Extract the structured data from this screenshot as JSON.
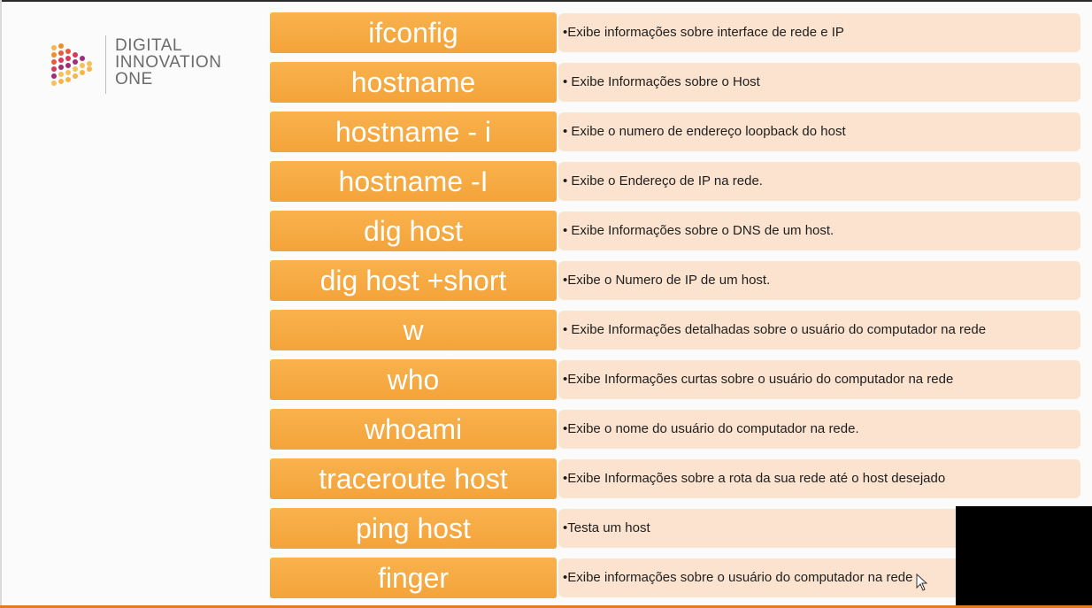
{
  "logo": {
    "line1": "DIGITAL",
    "line2": "INNOVATION",
    "line3": "ONE"
  },
  "colors": {
    "command_bg": "#f4a33a",
    "description_bg": "#fbe3d0",
    "accent_bottom": "#e07b23"
  },
  "commands": [
    {
      "name": "ifconfig",
      "desc": "•Exibe informações sobre interface de rede e IP"
    },
    {
      "name": "hostname",
      "desc": "• Exibe Informações sobre o Host"
    },
    {
      "name": "hostname - i",
      "desc": "• Exibe o numero de endereço loopback do host"
    },
    {
      "name": "hostname -I",
      "desc": "• Exibe o Endereço de IP na rede."
    },
    {
      "name": "dig host",
      "desc": "• Exibe Informações sobre o DNS de um host."
    },
    {
      "name": "dig host +short",
      "desc": "•Exibe o Numero de IP de um host."
    },
    {
      "name": "w",
      "desc": "• Exibe Informações detalhadas sobre o usuário do computador na rede"
    },
    {
      "name": "who",
      "desc": "•Exibe Informações curtas sobre o usuário do computador na rede"
    },
    {
      "name": "whoami",
      "desc": "•Exibe o nome do usuário do computador na rede."
    },
    {
      "name": "traceroute host",
      "desc": "•Exibe Informações sobre a rota da sua rede até o host desejado"
    },
    {
      "name": "ping host",
      "desc": "•Testa um host"
    },
    {
      "name": "finger",
      "desc": "•Exibe informações sobre o usuário do computador na rede"
    }
  ]
}
